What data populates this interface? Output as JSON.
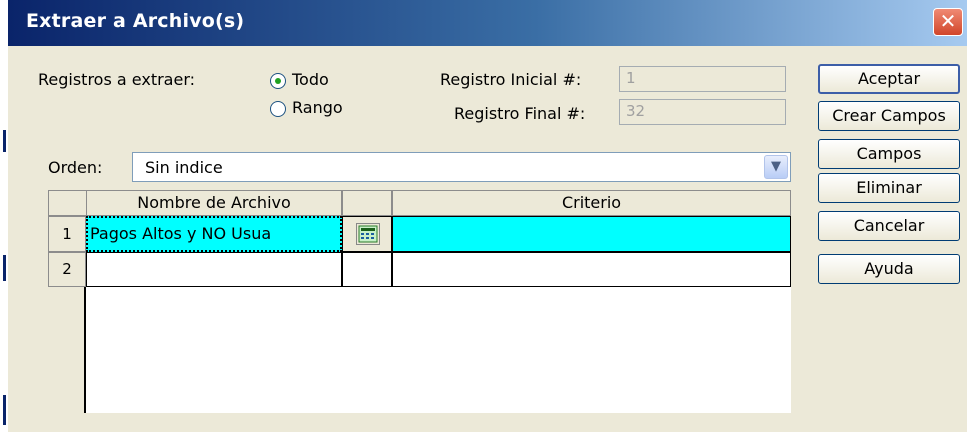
{
  "window": {
    "title": "Extraer a Archivo(s)",
    "close_glyph": "✕"
  },
  "extract": {
    "label": "Registros a extraer:",
    "options": [
      {
        "label": "Todo",
        "selected": true
      },
      {
        "label": "Rango",
        "selected": false
      }
    ],
    "initial_label": "Registro Inicial #:",
    "initial_value": "1",
    "final_label": "Registro Final #:",
    "final_value": "32"
  },
  "order": {
    "label": "Orden:",
    "value": "Sin indice"
  },
  "grid": {
    "columns": [
      "Nombre de Archivo",
      "",
      "Criterio"
    ],
    "rows": [
      {
        "num": "1",
        "filename": "Pagos Altos y NO Usua",
        "criteria": "",
        "selected": true
      },
      {
        "num": "2",
        "filename": "",
        "criteria": "",
        "selected": false
      }
    ]
  },
  "buttons": [
    "Aceptar",
    "Crear Campos",
    "Campos",
    "Eliminar",
    "Cancelar",
    "Ayuda"
  ],
  "colors": {
    "selected_row": "#00ffff",
    "title_gradient_start": "#0a246a",
    "dialog_bg": "#ece9d8"
  }
}
